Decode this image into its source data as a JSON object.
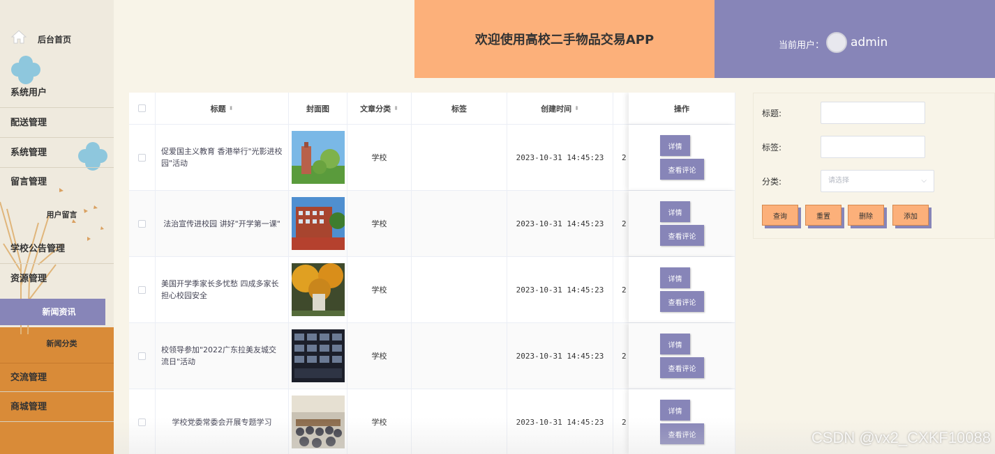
{
  "sidebar": {
    "home_label": "后台首页",
    "menu": [
      "系统用户",
      "配送管理",
      "系统管理",
      "留言管理",
      "学校公告管理",
      "资源管理",
      "交流管理",
      "商城管理"
    ],
    "sub_user_message": "用户留言",
    "active": "新闻资讯",
    "sub_news_category": "新闻分类"
  },
  "header": {
    "title": "欢迎使用高校二手物品交易APP",
    "user_label": "当前用户：",
    "username": "admin"
  },
  "table": {
    "columns": [
      "标题",
      "封面图",
      "文章分类",
      "标签",
      "创建时间",
      "操作"
    ],
    "rows": [
      {
        "title": "促爱国主义教育 香港举行\"光影进校园\"活动",
        "category": "学校",
        "tag": "",
        "created": "2023-10-31 14:45:23",
        "extra": "2"
      },
      {
        "title": "法治宣传进校园 讲好\"开学第一课\"",
        "category": "学校",
        "tag": "",
        "created": "2023-10-31 14:45:23",
        "extra": "2"
      },
      {
        "title": "美国开学季家长多忧愁 四成多家长担心校园安全",
        "category": "学校",
        "tag": "",
        "created": "2023-10-31 14:45:23",
        "extra": "2"
      },
      {
        "title": "校领导参加\"2022广东拉美友城交流日\"活动",
        "category": "学校",
        "tag": "",
        "created": "2023-10-31 14:45:23",
        "extra": "2"
      },
      {
        "title": "学校党委常委会开展专题学习",
        "category": "学校",
        "tag": "",
        "created": "2023-10-31 14:45:23",
        "extra": "2"
      }
    ],
    "btn_detail": "详情",
    "btn_comment": "查看评论"
  },
  "search": {
    "title_label": "标题:",
    "tag_label": "标签:",
    "category_label": "分类:",
    "category_placeholder": "请选择",
    "btn_query": "查询",
    "btn_reset": "重置",
    "btn_delete": "删除",
    "btn_add": "添加"
  },
  "watermark": "CSDN @vx2_CXKF10088",
  "colors": {
    "accent_purple": "#8785b8",
    "accent_orange": "#fcb07a",
    "sidebar_orange": "#d98b38",
    "background": "#f8f4e8"
  }
}
